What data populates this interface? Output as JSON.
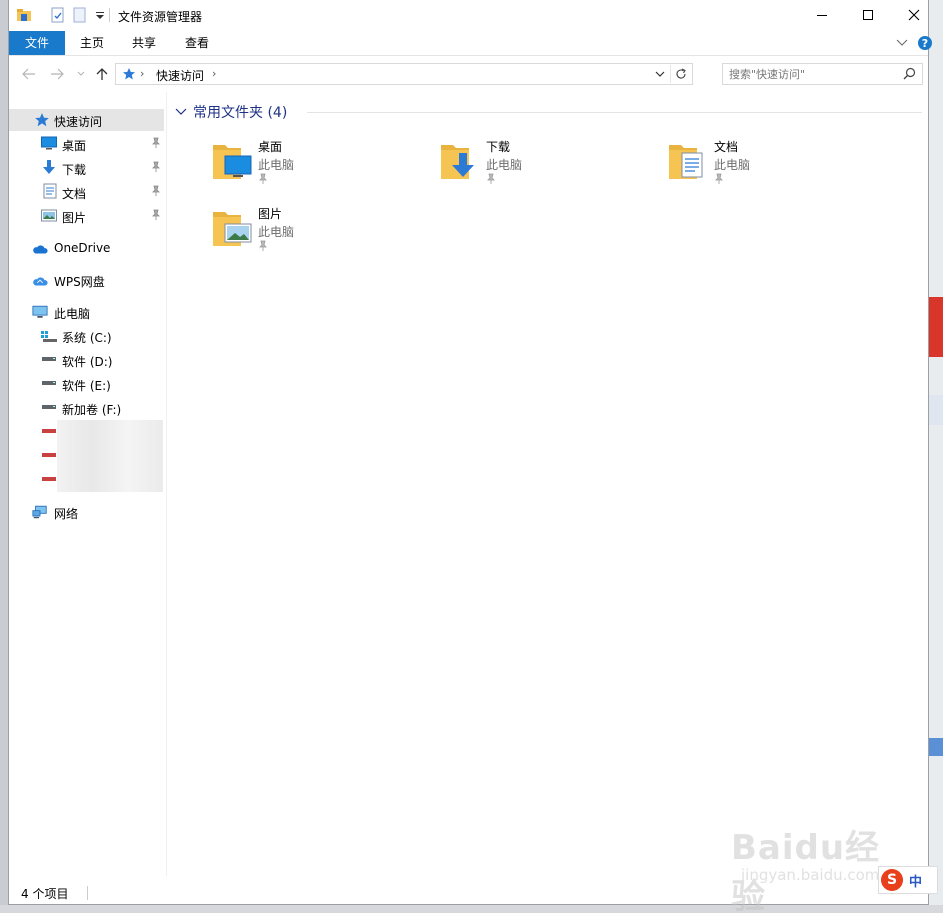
{
  "window": {
    "title": "文件资源管理器"
  },
  "ribbon": {
    "tabs": [
      "文件",
      "主页",
      "共享",
      "查看"
    ]
  },
  "address": {
    "location": "快速访问"
  },
  "search": {
    "placeholder": "搜索\"快速访问\""
  },
  "nav": {
    "quick_access": "快速访问",
    "pinned": [
      "桌面",
      "下载",
      "文档",
      "图片"
    ],
    "onedrive": "OneDrive",
    "wps": "WPS网盘",
    "this_pc": "此电脑",
    "drives": [
      "系统 (C:)",
      "软件 (D:)",
      "软件 (E:)",
      "新加卷 (F:)"
    ],
    "network": "网络"
  },
  "content": {
    "group_title": "常用文件夹 (4)",
    "folders": [
      {
        "name": "桌面",
        "location": "此电脑",
        "icon": "desktop-folder-icon"
      },
      {
        "name": "下载",
        "location": "此电脑",
        "icon": "downloads-folder-icon"
      },
      {
        "name": "文档",
        "location": "此电脑",
        "icon": "documents-folder-icon"
      },
      {
        "name": "图片",
        "location": "此电脑",
        "icon": "pictures-folder-icon"
      }
    ]
  },
  "status": {
    "item_count": "4 个项目"
  },
  "watermark": {
    "brand": "Baidu经验",
    "url": "jingyan.baidu.com"
  },
  "ime": {
    "mode": "中"
  },
  "colors": {
    "accent": "#1979ca",
    "group_title": "#1e3287",
    "selected_bg": "#e5e5e5",
    "folder_yellow": "#f5c452"
  }
}
